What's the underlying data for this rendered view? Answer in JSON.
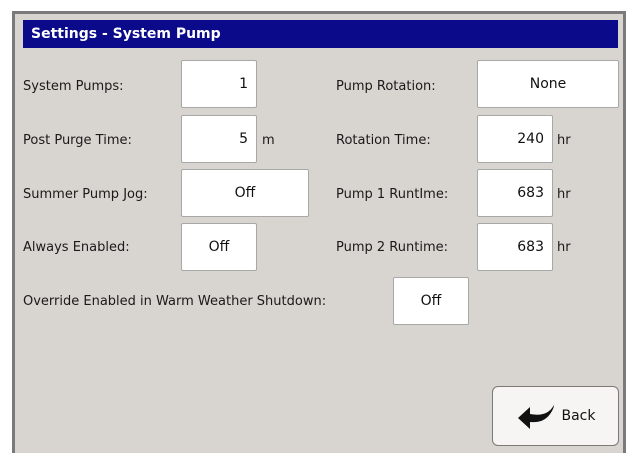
{
  "window": {
    "title": "Settings - System Pump"
  },
  "left": {
    "system_pumps": {
      "label": "System Pumps:",
      "value": "1"
    },
    "post_purge_time": {
      "label": "Post Purge Time:",
      "value": "5",
      "unit": "m"
    },
    "summer_pump_jog": {
      "label": "Summer Pump Jog:",
      "value": "Off"
    },
    "always_enabled": {
      "label": "Always Enabled:",
      "value": "Off"
    }
  },
  "right": {
    "pump_rotation": {
      "label": "Pump Rotation:",
      "value": "None"
    },
    "rotation_time": {
      "label": "Rotation Time:",
      "value": "240",
      "unit": "hr"
    },
    "pump1_runtime": {
      "label": "Pump 1 RuntIme:",
      "value": "683",
      "unit": "hr"
    },
    "pump2_runtime": {
      "label": "Pump 2 Runtime:",
      "value": "683",
      "unit": "hr"
    }
  },
  "override": {
    "label": "Override Enabled in Warm Weather Shutdown:",
    "value": "Off"
  },
  "footer": {
    "back_label": "Back",
    "back_icon": "curved-back-arrow-icon"
  },
  "colors": {
    "titlebar": "#0a0a8a",
    "panel": "#d8d4d0",
    "field": "#ffffff"
  }
}
